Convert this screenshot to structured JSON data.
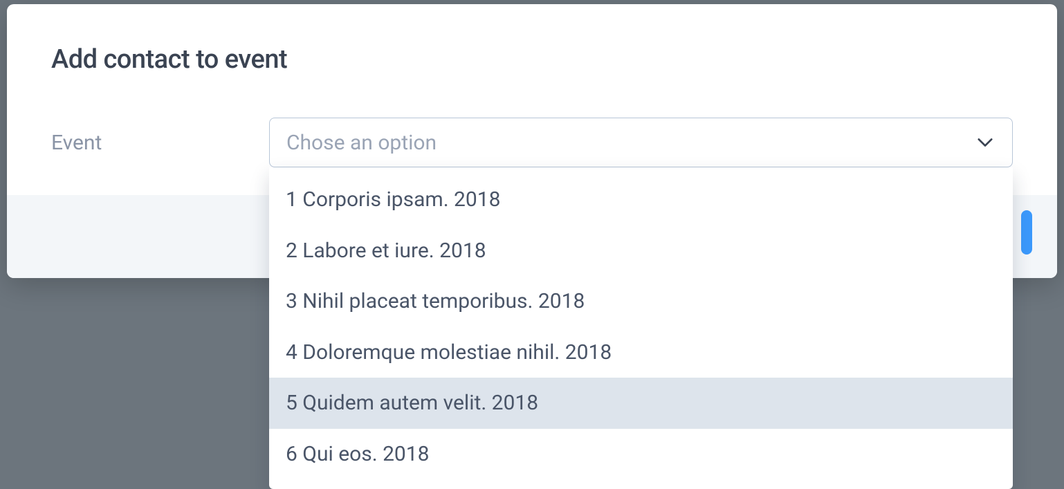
{
  "modal": {
    "title": "Add contact to event",
    "form": {
      "event_label": "Event",
      "select": {
        "placeholder": "Chose an option",
        "options": [
          {
            "label": "1 Corporis ipsam. 2018",
            "highlighted": false
          },
          {
            "label": "2 Labore et iure. 2018",
            "highlighted": false
          },
          {
            "label": "3 Nihil placeat temporibus. 2018",
            "highlighted": false
          },
          {
            "label": "4 Doloremque molestiae nihil. 2018",
            "highlighted": false
          },
          {
            "label": "5 Quidem autem velit. 2018",
            "highlighted": true
          },
          {
            "label": "6 Qui eos. 2018",
            "highlighted": false
          }
        ]
      }
    }
  }
}
